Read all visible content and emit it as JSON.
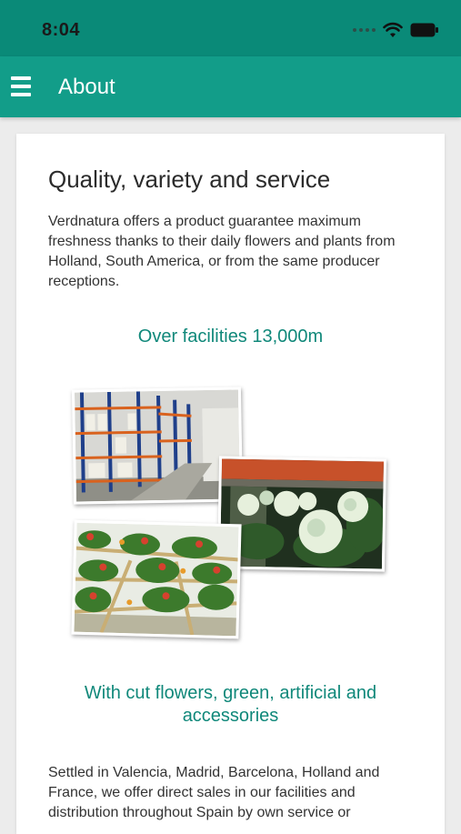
{
  "status_bar": {
    "time": "8:04"
  },
  "app_bar": {
    "title": "About"
  },
  "content": {
    "heading": "Quality, variety and service",
    "intro": "Verdnatura offers a product guarantee maximum freshness thanks to their daily flowers and plants from Holland, South America, or from the same producer receptions.",
    "facilities_heading": "Over facilities 13,000m",
    "products_heading": "With cut flowers, green, artificial and accessories",
    "distribution_text": "Settled in Valencia, Madrid, Barcelona, Holland and France, we offer direct sales in our facilities and distribution throughout Spain by own service or"
  },
  "colors": {
    "status_bar": "#0a8a78",
    "app_bar": "#129d89",
    "accent_text": "#10887a"
  }
}
